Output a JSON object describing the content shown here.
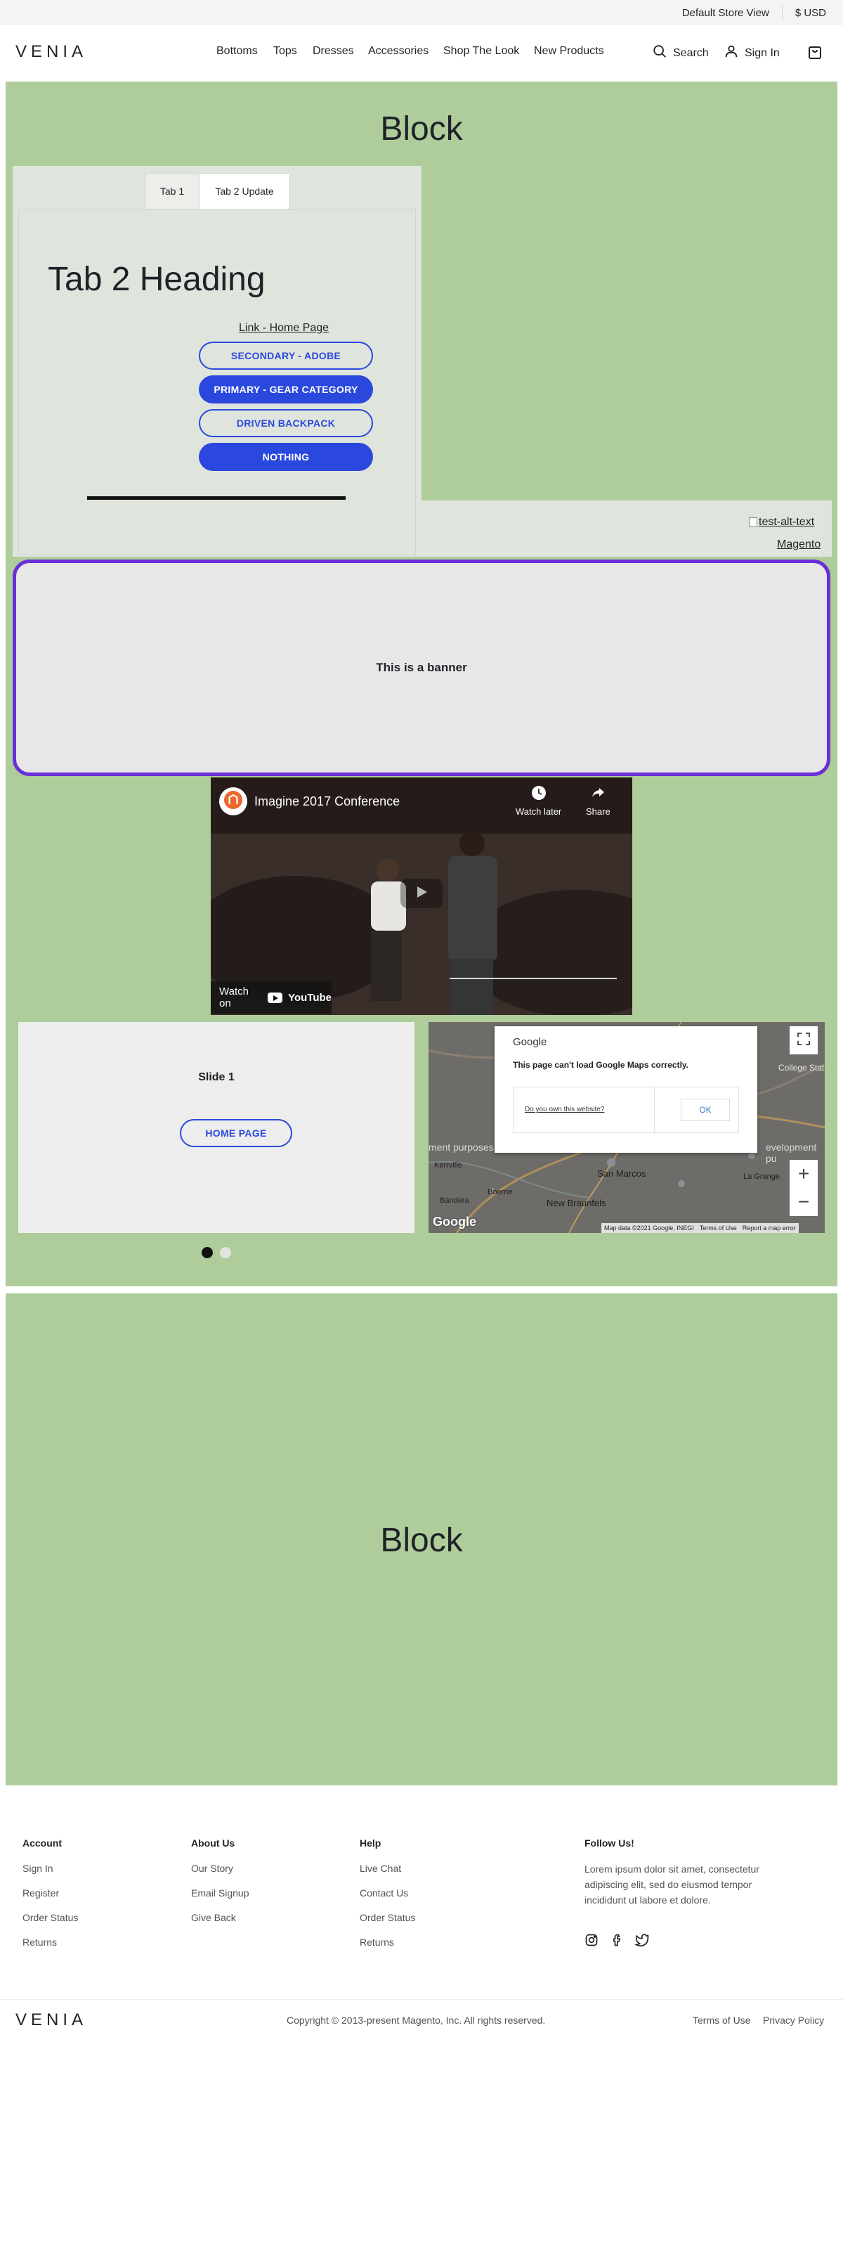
{
  "topbar": {
    "store_view": "Default Store View",
    "currency": "$ USD"
  },
  "header": {
    "logo": "VENIA",
    "nav": [
      "Bottoms",
      "Tops",
      "Dresses",
      "Accessories",
      "Shop The Look",
      "New Products"
    ],
    "search_label": "Search",
    "signin_label": "Sign In"
  },
  "block1": {
    "title": "Block",
    "tabs": [
      "Tab 1",
      "Tab 2 Update"
    ],
    "tab_heading": "Tab 2 Heading",
    "home_link": "Link - Home Page",
    "buttons": [
      "SECONDARY - ADOBE",
      "PRIMARY - GEAR CATEGORY",
      "DRIVEN BACKPACK",
      "NOTHING"
    ],
    "image_alt": "test-alt-text",
    "magento_link": "Magento",
    "banner_text": "This is a banner",
    "video": {
      "title": "Imagine 2017 Conference",
      "watch_later": "Watch later",
      "share": "Share",
      "watch_on": "Watch on",
      "youtube": "YouTube"
    },
    "slide": {
      "title": "Slide 1",
      "button": "HOME PAGE"
    },
    "map": {
      "dialog_brand": "Google",
      "dialog_message": "This page can't load Google Maps correctly.",
      "dialog_link": "Do you own this website?",
      "dialog_ok": "OK",
      "places": [
        "College Stat",
        "San Marcos",
        "New Braunfels",
        "La Grange",
        "Kerrville",
        "Bandera",
        "Boerne",
        "ment purposes",
        "evelopment pu"
      ],
      "footer_text": "Map data ©2021 Google, INEGI",
      "terms": "Terms of Use",
      "report": "Report a map error",
      "logo": "Google"
    }
  },
  "block2": {
    "title": "Block"
  },
  "footer": {
    "columns": [
      {
        "heading": "Account",
        "links": [
          "Sign In",
          "Register",
          "Order Status",
          "Returns"
        ]
      },
      {
        "heading": "About Us",
        "links": [
          "Our Story",
          "Email Signup",
          "Give Back"
        ]
      },
      {
        "heading": "Help",
        "links": [
          "Live Chat",
          "Contact Us",
          "Order Status",
          "Returns"
        ]
      }
    ],
    "follow": {
      "heading": "Follow Us!",
      "text": "Lorem ipsum dolor sit amet, consectetur adipiscing elit, sed do eiusmod tempor incididunt ut labore et dolore."
    },
    "logo": "VENIA",
    "copyright": "Copyright © 2013-present Magento, Inc. All rights reserved.",
    "terms": "Terms of Use",
    "privacy": "Privacy Policy"
  },
  "colors": {
    "green_block": "#afcd9b",
    "primary_blue": "#2a48de",
    "banner_border": "#6a2fd7",
    "logo_accent": "#3b4ad1"
  },
  "icons": [
    "search-icon",
    "user-icon",
    "cart-icon",
    "magento-icon",
    "clock-icon",
    "share-icon",
    "play-icon",
    "fullscreen-icon",
    "instagram-icon",
    "facebook-icon",
    "twitter-icon"
  ]
}
